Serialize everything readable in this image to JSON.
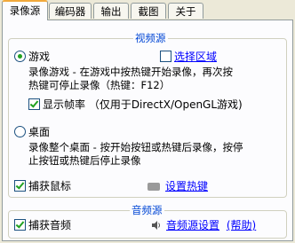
{
  "tabs": [
    "录像源",
    "编码器",
    "输出",
    "截图",
    "关于"
  ],
  "video_source": {
    "title": "视频源",
    "game_option": "游戏",
    "select_region": "选择区域",
    "game_desc_line1": "录像游戏 - 在游戏中按热键开始录像，再次按",
    "game_desc_line2": "热键可停止录像（热键：F12）",
    "show_fps": "显示帧率 （仅用于DirectX/OpenGL游戏)",
    "desktop_option": "桌面",
    "desktop_desc_line1": "录像整个桌面 - 按开始按钮或热键后录像，按停",
    "desktop_desc_line2": "止按钮或热键后停止录像",
    "capture_mouse": "捕获鼠标",
    "set_hotkey": "设置热键"
  },
  "audio_source": {
    "title": "音频源",
    "capture_audio": "捕获音频",
    "audio_settings": "音频源设置",
    "help": "(帮助)"
  }
}
